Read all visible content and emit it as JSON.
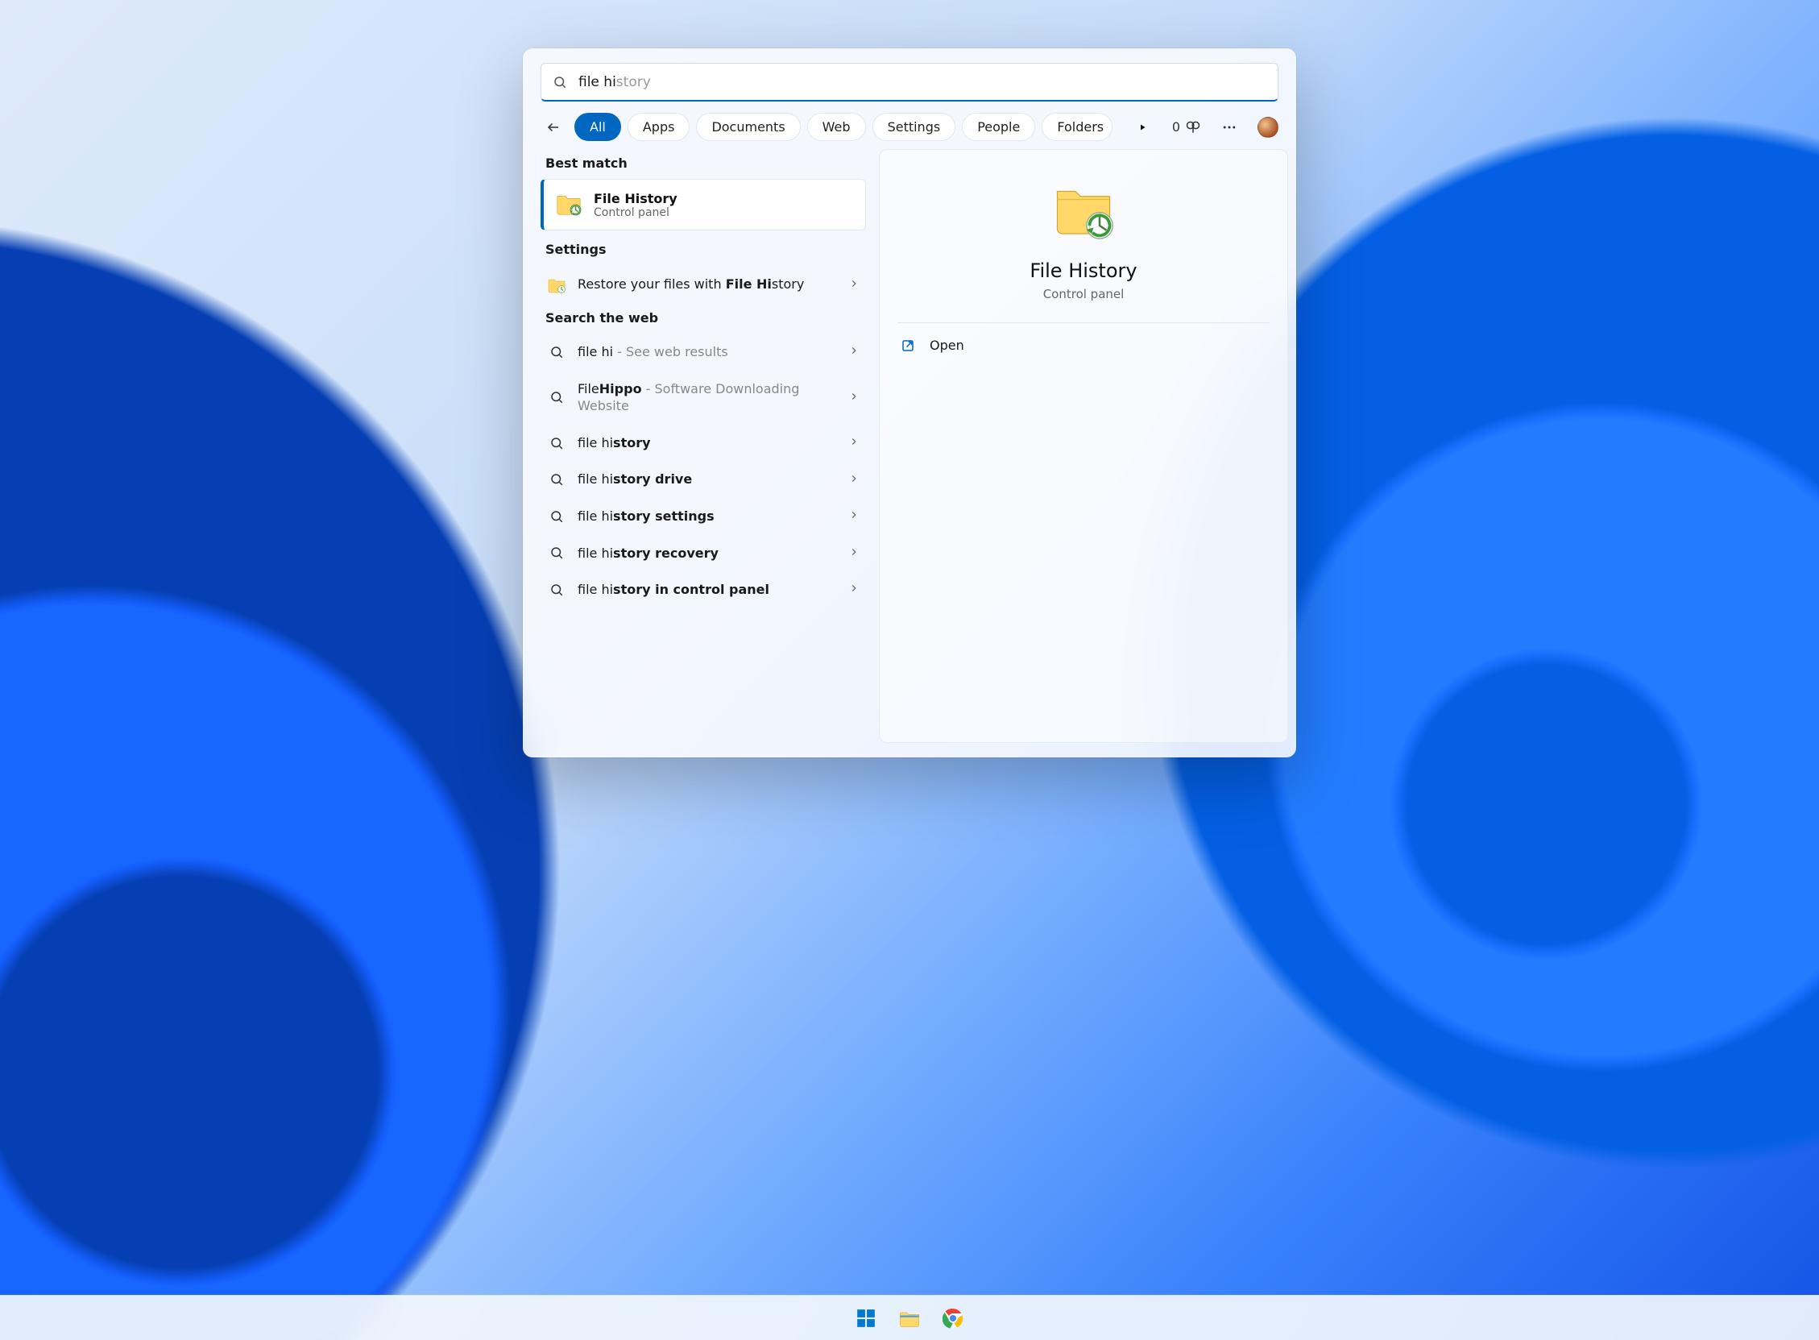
{
  "search": {
    "typed": "file hi",
    "suggestion_tail": "story"
  },
  "filters": {
    "active": "All",
    "items": [
      "All",
      "Apps",
      "Documents",
      "Web",
      "Settings",
      "People",
      "Folders"
    ]
  },
  "rewards": {
    "points": "0"
  },
  "sections": {
    "best_match": "Best match",
    "settings": "Settings",
    "web": "Search the web"
  },
  "best": {
    "title": "File History",
    "subtitle": "Control panel"
  },
  "settings_results": [
    {
      "prefix": "Restore your files with ",
      "bold": "File Hi",
      "suffix": "story"
    }
  ],
  "web_results": [
    {
      "prefix": "file hi",
      "bold": "",
      "suffix": "",
      "desc": " - See web results"
    },
    {
      "prefix": "File",
      "bold": "Hippo",
      "suffix": "",
      "desc": " - Software Downloading Website"
    },
    {
      "prefix": "file hi",
      "bold": "story",
      "suffix": "",
      "desc": ""
    },
    {
      "prefix": "file hi",
      "bold": "story drive",
      "suffix": "",
      "desc": ""
    },
    {
      "prefix": "file hi",
      "bold": "story settings",
      "suffix": "",
      "desc": ""
    },
    {
      "prefix": "file hi",
      "bold": "story recovery",
      "suffix": "",
      "desc": ""
    },
    {
      "prefix": "file hi",
      "bold": "story in control panel",
      "suffix": "",
      "desc": ""
    }
  ],
  "preview": {
    "title": "File History",
    "subtitle": "Control panel",
    "actions": [
      {
        "label": "Open",
        "icon": "open-external"
      }
    ]
  }
}
